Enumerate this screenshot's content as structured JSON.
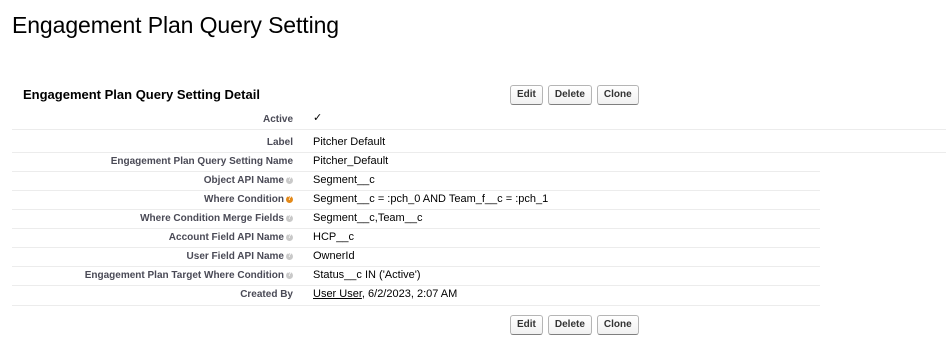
{
  "page": {
    "title": "Engagement Plan Query Setting"
  },
  "detail": {
    "section_title": "Engagement Plan Query Setting Detail",
    "buttons": {
      "edit": "Edit",
      "delete": "Delete",
      "clone": "Clone"
    },
    "fields": {
      "active": {
        "label": "Active",
        "value": "✓"
      },
      "label": {
        "label": "Label",
        "value": "Pitcher Default"
      },
      "name": {
        "label": "Engagement Plan Query Setting Name",
        "value": "Pitcher_Default"
      },
      "object_api": {
        "label": "Object API Name",
        "value": "Segment__c"
      },
      "where_condition": {
        "label": "Where Condition",
        "value": "Segment__c = :pch_0 AND Team_f__c = :pch_1"
      },
      "merge_fields": {
        "label": "Where Condition Merge Fields",
        "value": "Segment__c,Team__c"
      },
      "account_field": {
        "label": "Account Field API Name",
        "value": "HCP__c"
      },
      "user_field": {
        "label": "User Field API Name",
        "value": "OwnerId"
      },
      "target_where": {
        "label": "Engagement Plan Target Where Condition",
        "value": "Status__c IN ('Active')"
      },
      "created_by": {
        "label": "Created By",
        "user": "User User",
        "date": ", 6/2/2023, 2:07 AM"
      }
    }
  },
  "icons": {
    "help": "help-icon",
    "help_orange": "help-icon-orange",
    "check": "checkmark-icon"
  },
  "colors": {
    "label_text": "#4a4a56",
    "help_gray": "#c9c9c9",
    "help_orange": "#e48a1a",
    "divider": "#ececec"
  }
}
